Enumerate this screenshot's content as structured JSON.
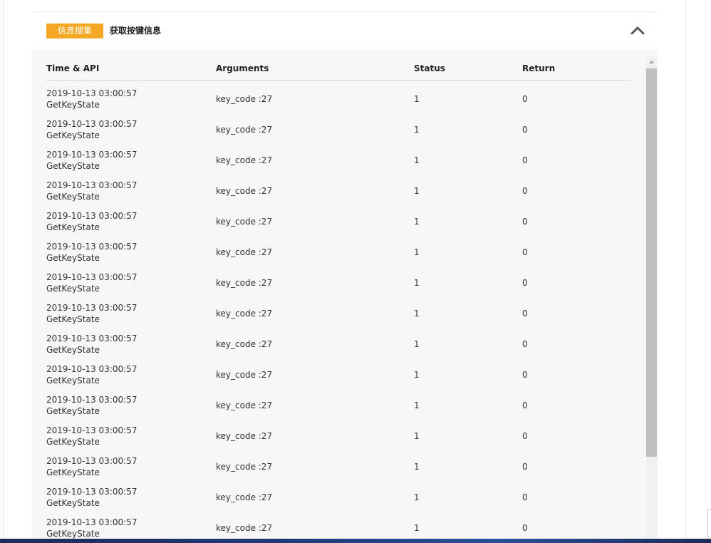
{
  "panel": {
    "tag": "信息搜集",
    "title": "获取按键信息",
    "collapse_icon": "chevron-up-icon"
  },
  "table": {
    "columns": [
      "Time & API",
      "Arguments",
      "Status",
      "Return"
    ],
    "rows": [
      {
        "time": "2019-10-13 03:00:57",
        "api": "GetKeyState",
        "arguments": "key_code :27",
        "status": "1",
        "return": "0"
      },
      {
        "time": "2019-10-13 03:00:57",
        "api": "GetKeyState",
        "arguments": "key_code :27",
        "status": "1",
        "return": "0"
      },
      {
        "time": "2019-10-13 03:00:57",
        "api": "GetKeyState",
        "arguments": "key_code :27",
        "status": "1",
        "return": "0"
      },
      {
        "time": "2019-10-13 03:00:57",
        "api": "GetKeyState",
        "arguments": "key_code :27",
        "status": "1",
        "return": "0"
      },
      {
        "time": "2019-10-13 03:00:57",
        "api": "GetKeyState",
        "arguments": "key_code :27",
        "status": "1",
        "return": "0"
      },
      {
        "time": "2019-10-13 03:00:57",
        "api": "GetKeyState",
        "arguments": "key_code :27",
        "status": "1",
        "return": "0"
      },
      {
        "time": "2019-10-13 03:00:57",
        "api": "GetKeyState",
        "arguments": "key_code :27",
        "status": "1",
        "return": "0"
      },
      {
        "time": "2019-10-13 03:00:57",
        "api": "GetKeyState",
        "arguments": "key_code :27",
        "status": "1",
        "return": "0"
      },
      {
        "time": "2019-10-13 03:00:57",
        "api": "GetKeyState",
        "arguments": "key_code :27",
        "status": "1",
        "return": "0"
      },
      {
        "time": "2019-10-13 03:00:57",
        "api": "GetKeyState",
        "arguments": "key_code :27",
        "status": "1",
        "return": "0"
      },
      {
        "time": "2019-10-13 03:00:57",
        "api": "GetKeyState",
        "arguments": "key_code :27",
        "status": "1",
        "return": "0"
      },
      {
        "time": "2019-10-13 03:00:57",
        "api": "GetKeyState",
        "arguments": "key_code :27",
        "status": "1",
        "return": "0"
      },
      {
        "time": "2019-10-13 03:00:57",
        "api": "GetKeyState",
        "arguments": "key_code :27",
        "status": "1",
        "return": "0"
      },
      {
        "time": "2019-10-13 03:00:57",
        "api": "GetKeyState",
        "arguments": "key_code :27",
        "status": "1",
        "return": "0"
      },
      {
        "time": "2019-10-13 03:00:57",
        "api": "GetKeyState",
        "arguments": "key_code :27",
        "status": "1",
        "return": "0"
      }
    ]
  },
  "scrollbar": {
    "up_icon": "scroll-up-arrow-icon",
    "thumb_fraction_visible": 0.8
  },
  "colors": {
    "tag_background": "#f5a623",
    "table_background": "#f7f7f7",
    "scroll_thumb": "#c1c1c1"
  }
}
